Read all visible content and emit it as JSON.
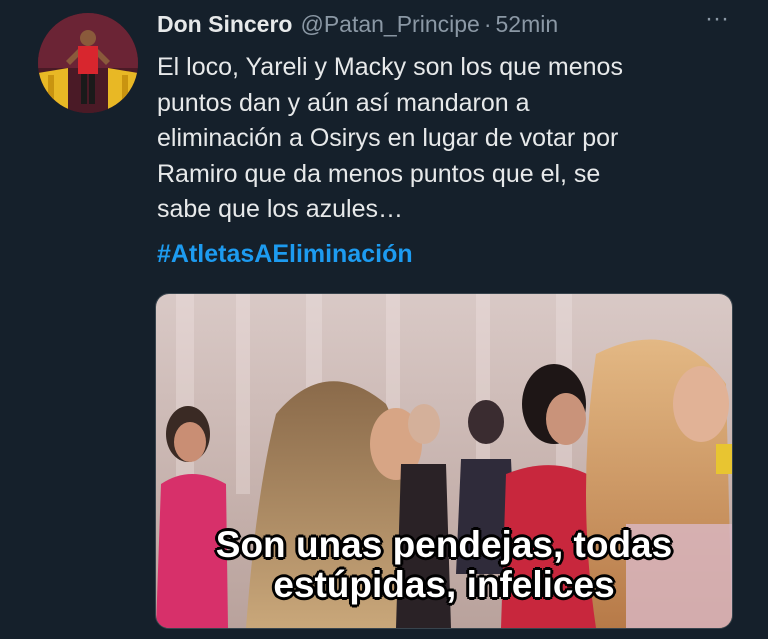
{
  "tweet": {
    "display_name": "Don Sincero",
    "handle": "@Patan_Principe",
    "separator": "·",
    "time": "52min",
    "more_label": "···",
    "body_lines": [
      "El loco, Yareli y Macky son los que menos",
      "puntos dan y aún así mandaron a",
      "eliminación a Osirys en lugar de votar por",
      "Ramiro que da menos puntos que el, se",
      "sabe que los azules…"
    ],
    "hashtag": "#AtletasAEliminación",
    "media": {
      "caption_line1": "Son unas pendejas, todas",
      "caption_line2": "estúpidas, infelices"
    }
  },
  "colors": {
    "background": "#15202b",
    "text": "#e7e9ea",
    "secondary": "#8b98a5",
    "link": "#1d9bf0"
  }
}
